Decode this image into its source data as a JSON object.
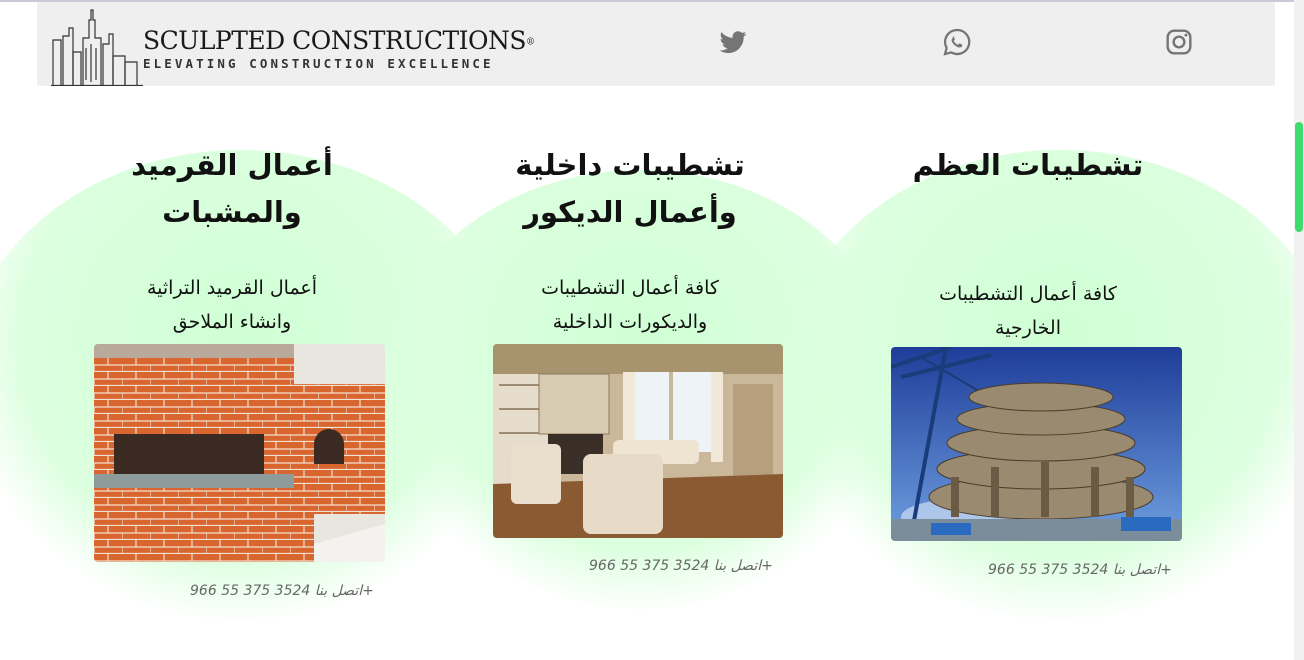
{
  "header": {
    "logo_title": "SCULPTED CONSTRUCTIONS",
    "logo_mark": "®",
    "logo_subtitle": "ELEVATING CONSTRUCTION EXCELLENCE",
    "social": [
      "twitter-icon",
      "whatsapp-icon",
      "instagram-icon"
    ]
  },
  "services": [
    {
      "title": "تشطيبات العظم",
      "description": "كافة أعمال التشطيبات الخارجية",
      "image": "building-under-construction-photo",
      "contact": "اتصل بنا 3524 375 55 966+"
    },
    {
      "title": "تشطيبات داخلية وأعمال الديكور",
      "description": "كافة أعمال التشطيبات والديكورات الداخلية",
      "image": "interior-living-room-photo",
      "contact": "اتصل بنا 3524 375 55 966+"
    },
    {
      "title": "أعمال القرميد والمشبات",
      "description": "أعمال القرميد التراثية وانشاء الملاحق",
      "image": "brick-fireplace-photo",
      "contact": "اتصل بنا 3524 375 55 966+"
    }
  ],
  "colors": {
    "accent_green": "#3ddc6f",
    "blob_green": "#d6ffd9",
    "header_bg": "#efefef"
  }
}
